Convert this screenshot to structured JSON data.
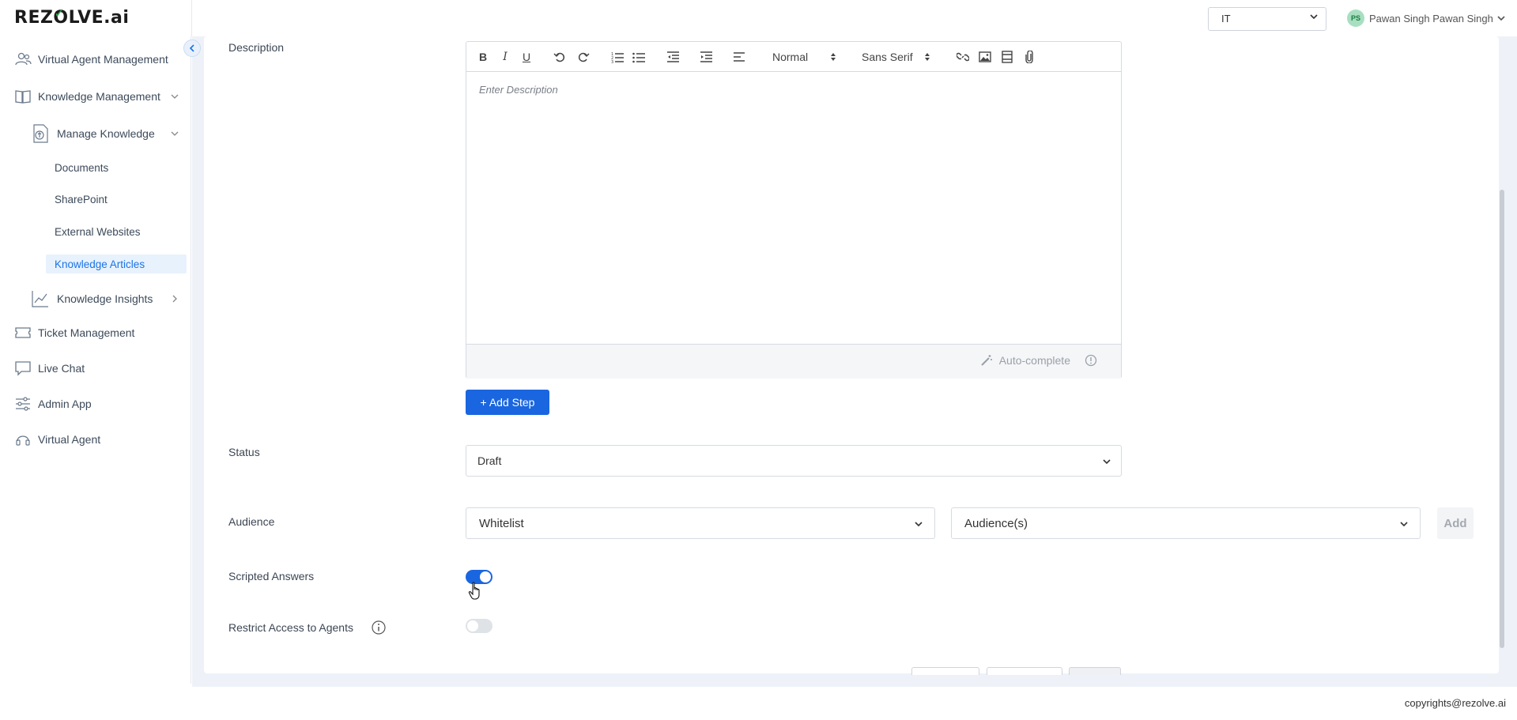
{
  "header": {
    "logo": {
      "prefix": "REZ",
      "o": "O",
      "suffix": "LVE",
      "ai": ".ai"
    },
    "tenant": "IT",
    "user": {
      "initials": "PS",
      "name": "Pawan Singh Pawan Singh"
    }
  },
  "sidebar": {
    "items": [
      {
        "label": "Virtual Agent Management",
        "icon": "users-icon"
      },
      {
        "label": "Knowledge Management",
        "icon": "book-icon"
      },
      {
        "label": "Manage Knowledge",
        "icon": "upload-doc-icon"
      },
      {
        "label": "Documents"
      },
      {
        "label": "SharePoint"
      },
      {
        "label": "External Websites"
      },
      {
        "label": "Knowledge Articles"
      },
      {
        "label": "Knowledge Insights",
        "icon": "chart-trend-icon"
      },
      {
        "label": "Ticket Management",
        "icon": "ticket-icon"
      },
      {
        "label": "Live Chat",
        "icon": "chat-icon"
      },
      {
        "label": "Admin App",
        "icon": "sliders-icon"
      },
      {
        "label": "Virtual Agent",
        "icon": "headset-icon"
      }
    ]
  },
  "form": {
    "description_label": "Description",
    "editor": {
      "placeholder": "Enter Description",
      "heading_select": "Normal",
      "font_select": "Sans Serif",
      "autocomplete": "Auto-complete"
    },
    "add_step": "+ Add Step",
    "status_label": "Status",
    "status_value": "Draft",
    "audience_label": "Audience",
    "audience_type": "Whitelist",
    "audience_placeholder": "Audience(s)",
    "audience_add": "Add",
    "scripted_label": "Scripted Answers",
    "scripted_on": true,
    "restrict_label": "Restrict Access to Agents",
    "restrict_on": false
  },
  "footer": {
    "copyright": "copyrights@rezolve.ai"
  },
  "colors": {
    "accent": "#1a66e0",
    "active_bg": "#e8f2fc",
    "content_bg": "#eef2f8"
  }
}
